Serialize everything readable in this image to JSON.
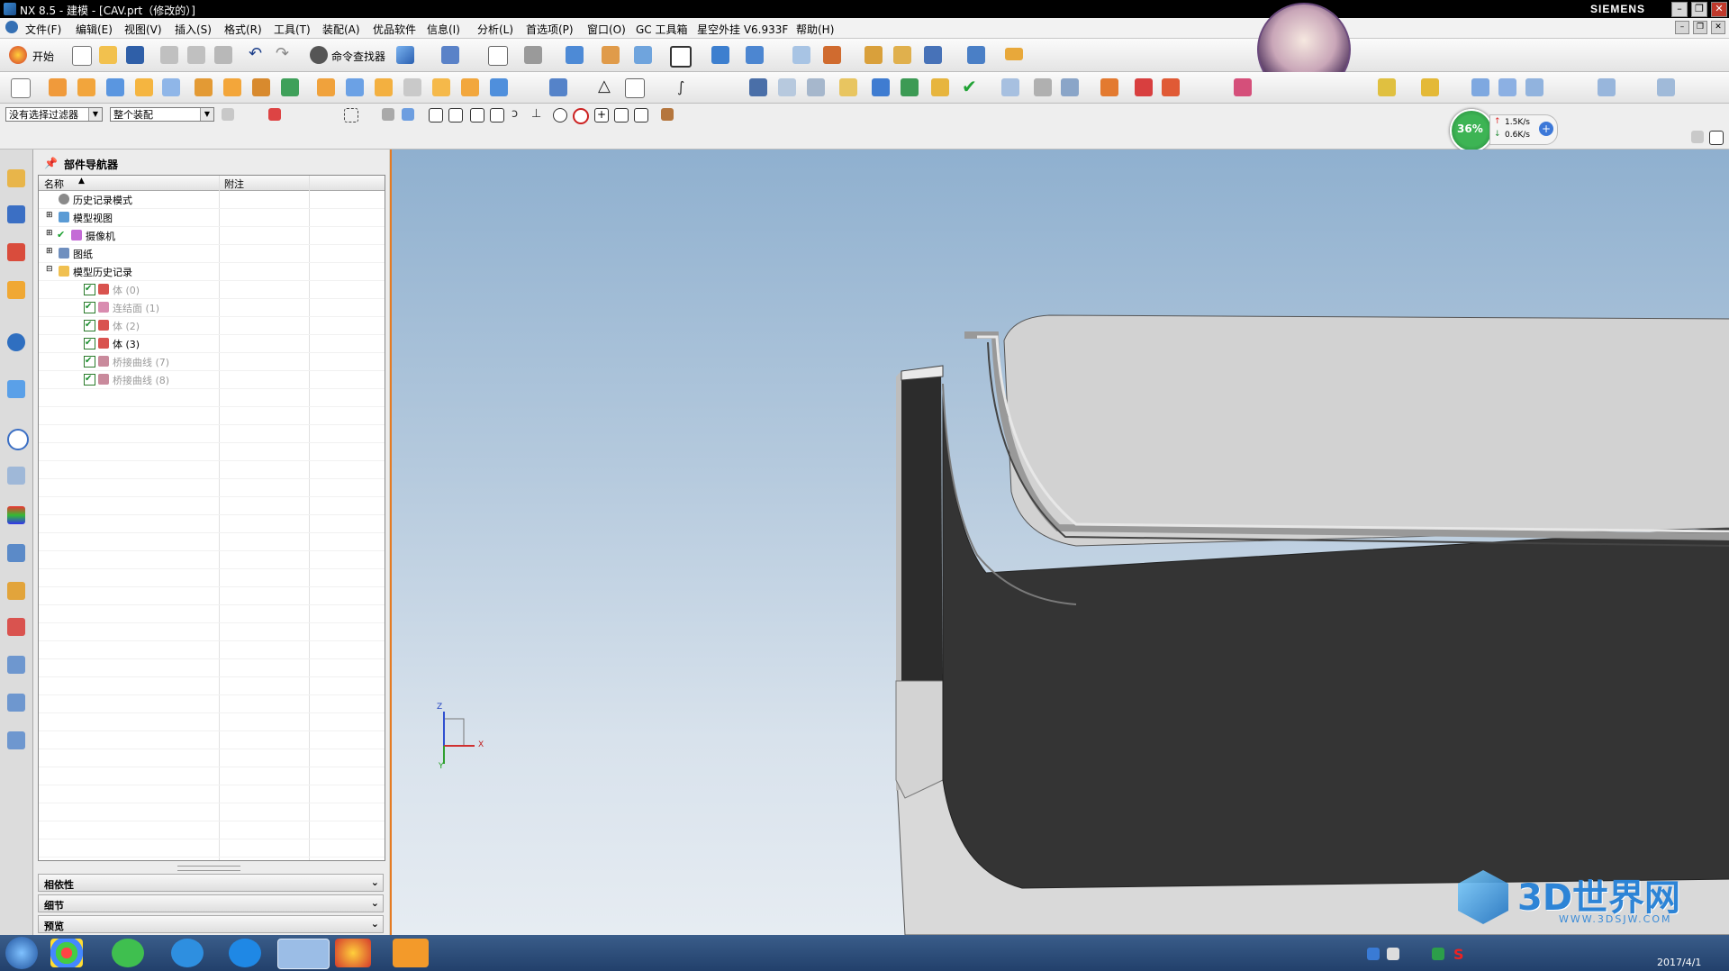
{
  "window": {
    "title": "NX 8.5 - 建模 - [CAV.prt（修改的）]",
    "brand": "SIEMENS",
    "buttons": [
      "–",
      "❐",
      "✕"
    ]
  },
  "menubar": {
    "items": [
      "文件(F)",
      "编辑(E)",
      "视图(V)",
      "插入(S)",
      "格式(R)",
      "工具(T)",
      "装配(A)",
      "优品软件",
      "信息(I)",
      "分析(L)",
      "首选项(P)",
      "窗口(O)",
      "GC 工具箱",
      "星空外挂 V6.933F",
      "帮助(H)"
    ]
  },
  "toolbar1": {
    "start_label": "开始",
    "command_finder_label": "命令查找器"
  },
  "selection_bar": {
    "filter_value": "没有选择过滤器",
    "scope_value": "整个装配"
  },
  "speed_widget": {
    "percent": "36%",
    "upload": "1.5K/s",
    "download": "0.6K/s",
    "percent_value": 0.36
  },
  "navigator": {
    "title": "部件导航器",
    "columns": [
      "名称",
      "附注"
    ],
    "nodes": [
      {
        "label": "历史记录模式",
        "icon": "clock-icon",
        "dim": false,
        "level": 0,
        "expander": ""
      },
      {
        "label": "模型视图",
        "icon": "model-views-icon",
        "dim": false,
        "level": 0,
        "expander": "+"
      },
      {
        "label": "摄像机",
        "icon": "camera-icon",
        "dim": false,
        "level": 0,
        "expander": "+"
      },
      {
        "label": "图纸",
        "icon": "drawing-icon",
        "dim": false,
        "level": 0,
        "expander": "+"
      },
      {
        "label": "模型历史记录",
        "icon": "folder-icon",
        "dim": false,
        "level": 0,
        "expander": "-"
      },
      {
        "label": "体 (0)",
        "icon": "body-icon",
        "dim": true,
        "level": 1,
        "expander": ""
      },
      {
        "label": "连结面 (1)",
        "icon": "linked-face-icon",
        "dim": true,
        "level": 1,
        "expander": ""
      },
      {
        "label": "体 (2)",
        "icon": "body-icon",
        "dim": true,
        "level": 1,
        "expander": ""
      },
      {
        "label": "体 (3)",
        "icon": "body-icon",
        "dim": false,
        "level": 1,
        "expander": ""
      },
      {
        "label": "桥接曲线 (7)",
        "icon": "bridge-curve-icon",
        "dim": true,
        "level": 1,
        "expander": ""
      },
      {
        "label": "桥接曲线 (8)",
        "icon": "bridge-curve-icon",
        "dim": true,
        "level": 1,
        "expander": ""
      }
    ],
    "panels": [
      "相依性",
      "细节",
      "预览"
    ]
  },
  "viewport": {
    "axis_labels": {
      "x": "X",
      "y": "Y",
      "z": "Z"
    }
  },
  "watermark": {
    "text": "3D世界网",
    "url": "WWW.3DSJW.COM"
  },
  "taskbar": {
    "date": "2017/4/1"
  },
  "colors": {
    "accent_orange": "#e57b23",
    "nav_highlight": "#2f6fb3",
    "model_dark": "#333333",
    "model_light": "#d4d4d4"
  }
}
